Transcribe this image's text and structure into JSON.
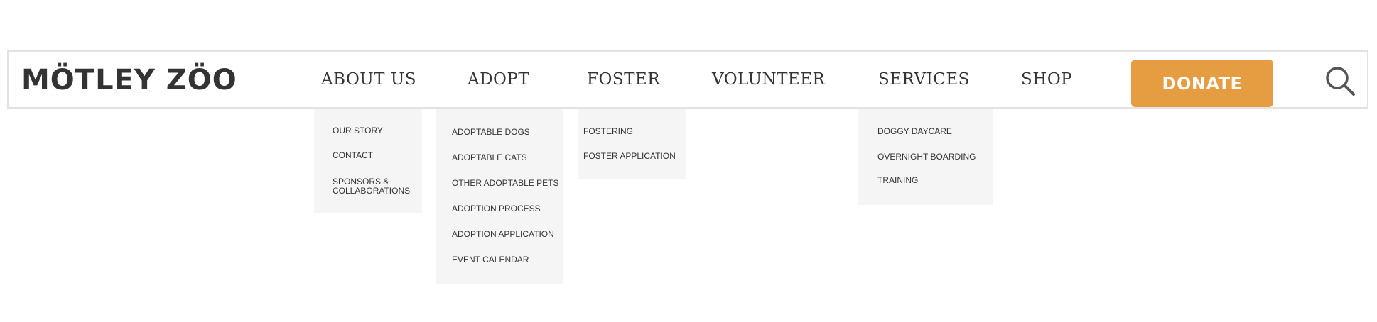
{
  "logo": {
    "text": "MÖTLEY ZÖO"
  },
  "nav": {
    "items": [
      {
        "label": "ABOUT US"
      },
      {
        "label": "ADOPT"
      },
      {
        "label": "FOSTER"
      },
      {
        "label": "VOLUNTEER"
      },
      {
        "label": "SERVICES"
      },
      {
        "label": "SHOP"
      }
    ],
    "donate_label": "DONATE",
    "search_icon": "search-icon"
  },
  "dropdowns": {
    "about": [
      "OUR STORY",
      "CONTACT",
      "SPONSORS &",
      "COLLABORATIONS"
    ],
    "adopt": [
      "ADOPTABLE DOGS",
      "ADOPTABLE CATS",
      "OTHER ADOPTABLE PETS",
      "ADOPTION PROCESS",
      "ADOPTION APPLICATION",
      "EVENT CALENDAR"
    ],
    "foster": [
      "FOSTERING",
      "FOSTER APPLICATION"
    ],
    "services": [
      "DOGGY DAYCARE",
      "OVERNIGHT BOARDING",
      "TRAINING"
    ]
  },
  "colors": {
    "donate": "#e69c40",
    "text": "#333333",
    "dropdown_bg": "#f5f5f5",
    "border": "#e2e2e2"
  }
}
